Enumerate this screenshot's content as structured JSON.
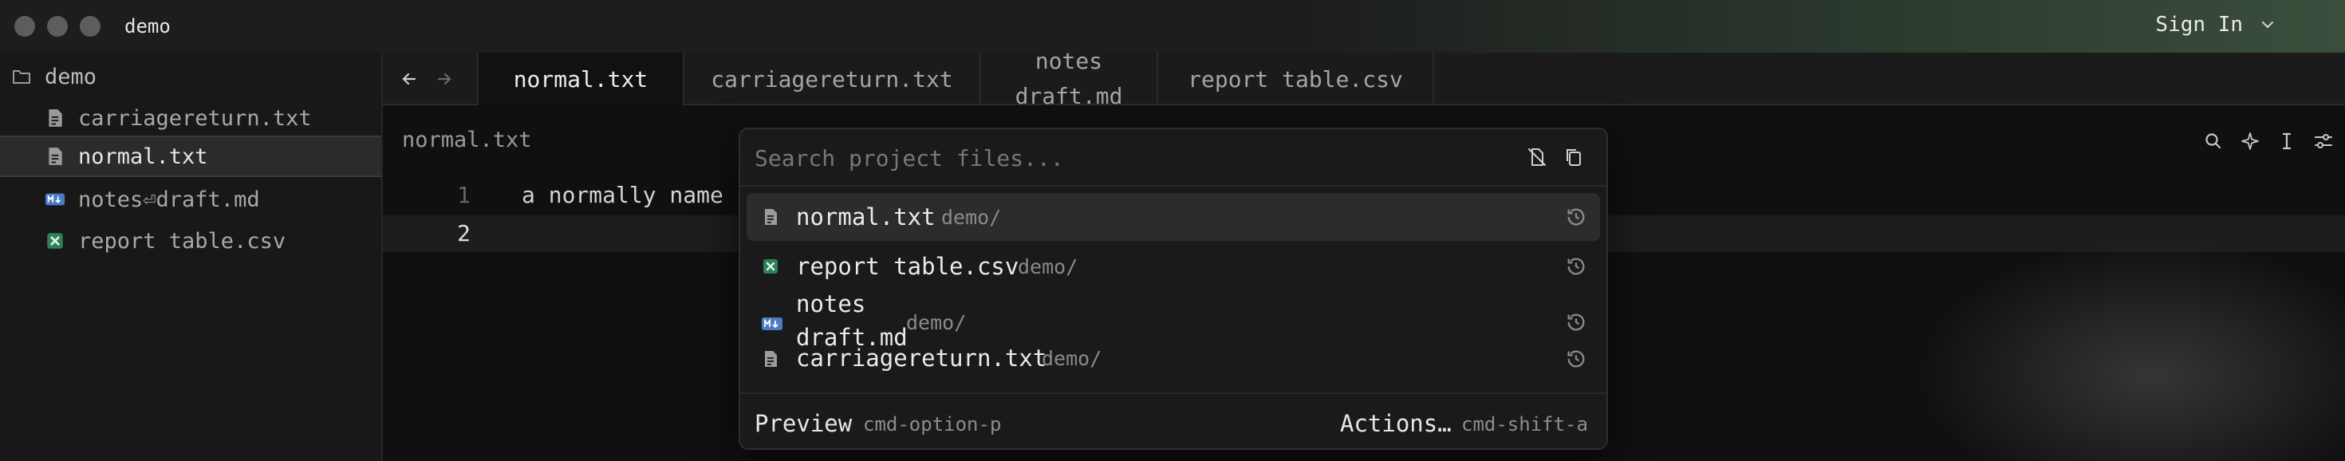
{
  "window": {
    "title": "demo",
    "sign_in": "Sign In"
  },
  "sidebar": {
    "root": "demo",
    "items": [
      {
        "label": "carriagereturn.txt",
        "icon": "text-file-icon"
      },
      {
        "label": "normal.txt",
        "icon": "text-file-icon",
        "selected": true
      },
      {
        "label": "notes⏎draft.md",
        "icon": "markdown-icon"
      },
      {
        "label": "report table.csv",
        "icon": "spreadsheet-icon"
      }
    ]
  },
  "tabs": {
    "items": [
      {
        "label": "normal.txt",
        "active": true
      },
      {
        "label": "carriagereturn.txt"
      },
      {
        "label_line1": "notes",
        "label_line2": "draft.md"
      },
      {
        "label": "report table.csv"
      }
    ]
  },
  "editor": {
    "breadcrumb": "normal.txt",
    "lines": [
      {
        "number": "1",
        "text": "a normally name"
      },
      {
        "number": "2",
        "text": ""
      }
    ]
  },
  "finder": {
    "placeholder": "Search project files...",
    "results": [
      {
        "name": "normal.txt",
        "path": "demo/",
        "icon": "text-file-icon"
      },
      {
        "name": "report table.csv",
        "path": "demo/",
        "icon": "spreadsheet-icon"
      },
      {
        "name_line1": "notes",
        "name_line2": "draft.md",
        "path": "demo/",
        "icon": "markdown-icon"
      },
      {
        "name": "carriagereturn.txt",
        "path": "demo/",
        "icon": "text-file-icon"
      }
    ],
    "footer": {
      "preview_label": "Preview",
      "preview_key": "cmd-option-p",
      "actions_label": "Actions…",
      "actions_key": "cmd-shift-a"
    }
  },
  "colors": {
    "accent_csv": "#3fb57e",
    "accent_md": "#5b8fd6",
    "selection": "#2c2c2c"
  }
}
